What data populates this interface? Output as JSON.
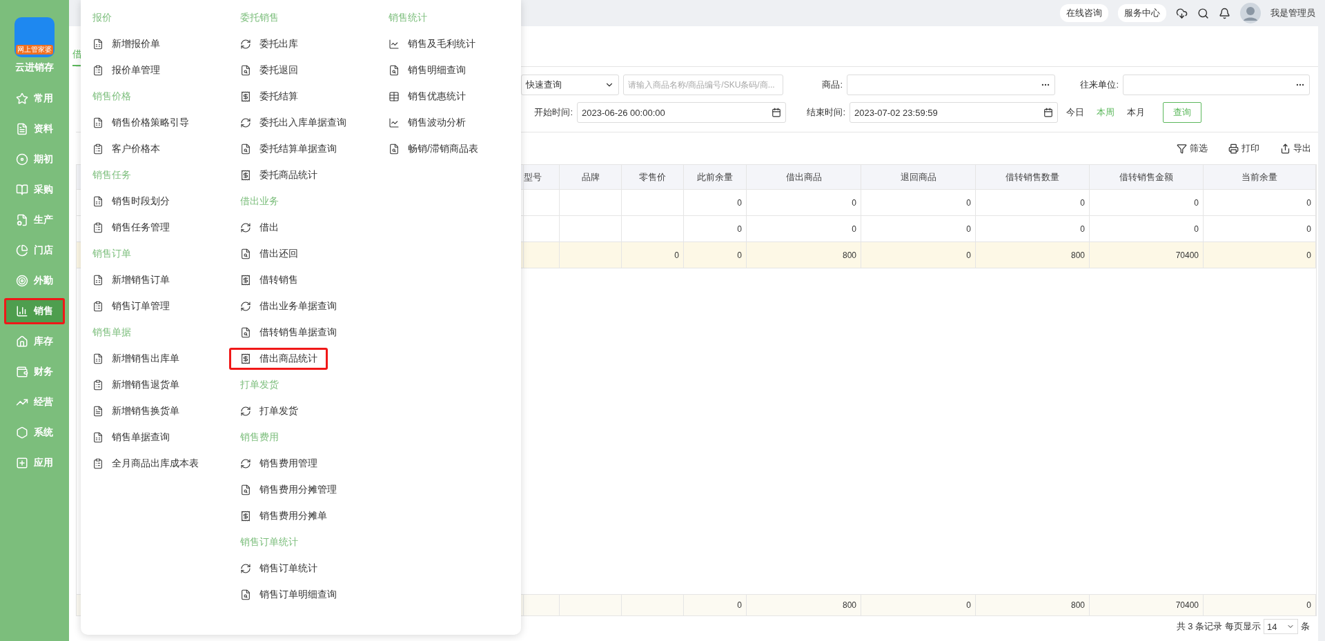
{
  "app": {
    "logo_badge": "网上管家婆",
    "name": "云进销存"
  },
  "sidebar": {
    "items": [
      {
        "label": "常用",
        "selected": false,
        "highlighted": false
      },
      {
        "label": "资料",
        "selected": false,
        "highlighted": false
      },
      {
        "label": "期初",
        "selected": false,
        "highlighted": false
      },
      {
        "label": "采购",
        "selected": false,
        "highlighted": false
      },
      {
        "label": "生产",
        "selected": false,
        "highlighted": false
      },
      {
        "label": "门店",
        "selected": false,
        "highlighted": false
      },
      {
        "label": "外勤",
        "selected": false,
        "highlighted": false
      },
      {
        "label": "销售",
        "selected": true,
        "highlighted": true
      },
      {
        "label": "库存",
        "selected": false,
        "highlighted": false
      },
      {
        "label": "财务",
        "selected": false,
        "highlighted": false
      },
      {
        "label": "经营",
        "selected": false,
        "highlighted": false
      },
      {
        "label": "系统",
        "selected": false,
        "highlighted": false
      },
      {
        "label": "应用",
        "selected": false,
        "highlighted": false
      }
    ]
  },
  "header": {
    "buttons": [
      "在线咨询",
      "服务中心"
    ],
    "user": "我是管理员"
  },
  "tab": {
    "label": "借",
    "selected": true
  },
  "filters": {
    "mode": "快速查询",
    "search_placeholder": "请输入商品名称/商品编号/SKU条码/商...",
    "product_label": "商品:",
    "partner_label": "往来单位:",
    "start_label": "开始时间:",
    "start_value": "2023-06-26 00:00:00",
    "end_label": "结束时间:",
    "end_value": "2023-07-02 23:59:59",
    "quick_ranges": [
      {
        "label": "今日",
        "selected": false
      },
      {
        "label": "本周",
        "selected": true
      },
      {
        "label": "本月",
        "selected": false
      }
    ],
    "query_button": "查询"
  },
  "toolbar": [
    "筛选",
    "打印",
    "导出"
  ],
  "table": {
    "columns": [
      "型号",
      "品牌",
      "零售价",
      "此前余量",
      "借出商品",
      "退回商品",
      "借转销售数量",
      "借转销售金额",
      "当前余量"
    ],
    "rows": [
      {
        "selected": false,
        "cells": [
          "",
          "",
          "",
          "0",
          "0",
          "0",
          "0",
          "0",
          "0"
        ]
      },
      {
        "selected": false,
        "cells": [
          "",
          "",
          "",
          "0",
          "0",
          "0",
          "0",
          "0",
          "0"
        ]
      },
      {
        "selected": true,
        "cells": [
          "",
          "",
          "0",
          "0",
          "800",
          "0",
          "800",
          "70400",
          "0"
        ]
      }
    ],
    "summary": [
      "0",
      "800",
      "0",
      "800",
      "70400",
      "0"
    ]
  },
  "pagination": {
    "total": "共 3 条记录",
    "per_page_label": "每页显示",
    "per_page": "14",
    "unit": "条"
  },
  "menu": {
    "columns": [
      [
        {
          "heading": "报价",
          "items": [
            {
              "label": "新增报价单",
              "highlighted": false
            },
            {
              "label": "报价单管理",
              "highlighted": false
            }
          ]
        },
        {
          "heading": "销售价格",
          "items": [
            {
              "label": "销售价格策略引导",
              "highlighted": false
            },
            {
              "label": "客户价格本",
              "highlighted": false
            }
          ]
        },
        {
          "heading": "销售任务",
          "items": [
            {
              "label": "销售时段划分",
              "highlighted": false
            },
            {
              "label": "销售任务管理",
              "highlighted": false
            }
          ]
        },
        {
          "heading": "销售订单",
          "items": [
            {
              "label": "新增销售订单",
              "highlighted": false
            },
            {
              "label": "销售订单管理",
              "highlighted": false
            }
          ]
        },
        {
          "heading": "销售单据",
          "items": [
            {
              "label": "新增销售出库单",
              "highlighted": false
            },
            {
              "label": "新增销售退货单",
              "highlighted": false
            },
            {
              "label": "新增销售换货单",
              "highlighted": false
            },
            {
              "label": "销售单据查询",
              "highlighted": false
            },
            {
              "label": "全月商品出库成本表",
              "highlighted": false
            }
          ]
        }
      ],
      [
        {
          "heading": "委托销售",
          "items": [
            {
              "label": "委托出库",
              "highlighted": false
            },
            {
              "label": "委托退回",
              "highlighted": false
            },
            {
              "label": "委托结算",
              "highlighted": false
            },
            {
              "label": "委托出入库单据查询",
              "highlighted": false
            },
            {
              "label": "委托结算单据查询",
              "highlighted": false
            },
            {
              "label": "委托商品统计",
              "highlighted": false
            }
          ]
        },
        {
          "heading": "借出业务",
          "items": [
            {
              "label": "借出",
              "highlighted": false
            },
            {
              "label": "借出还回",
              "highlighted": false
            },
            {
              "label": "借转销售",
              "highlighted": false
            },
            {
              "label": "借出业务单据查询",
              "highlighted": false
            },
            {
              "label": "借转销售单据查询",
              "highlighted": false
            },
            {
              "label": "借出商品统计",
              "highlighted": true
            }
          ]
        },
        {
          "heading": "打单发货",
          "items": [
            {
              "label": "打单发货",
              "highlighted": false
            }
          ]
        },
        {
          "heading": "销售费用",
          "items": [
            {
              "label": "销售费用管理",
              "highlighted": false
            },
            {
              "label": "销售费用分摊管理",
              "highlighted": false
            },
            {
              "label": "销售费用分摊单",
              "highlighted": false
            }
          ]
        },
        {
          "heading": "销售订单统计",
          "items": [
            {
              "label": "销售订单统计",
              "highlighted": false
            },
            {
              "label": "销售订单明细查询",
              "highlighted": false
            }
          ]
        }
      ],
      [
        {
          "heading": "销售统计",
          "items": [
            {
              "label": "销售及毛利统计",
              "highlighted": false
            },
            {
              "label": "销售明细查询",
              "highlighted": false
            },
            {
              "label": "销售优惠统计",
              "highlighted": false
            },
            {
              "label": "销售波动分析",
              "highlighted": false
            },
            {
              "label": "畅销/滞销商品表",
              "highlighted": false
            }
          ]
        }
      ]
    ]
  }
}
